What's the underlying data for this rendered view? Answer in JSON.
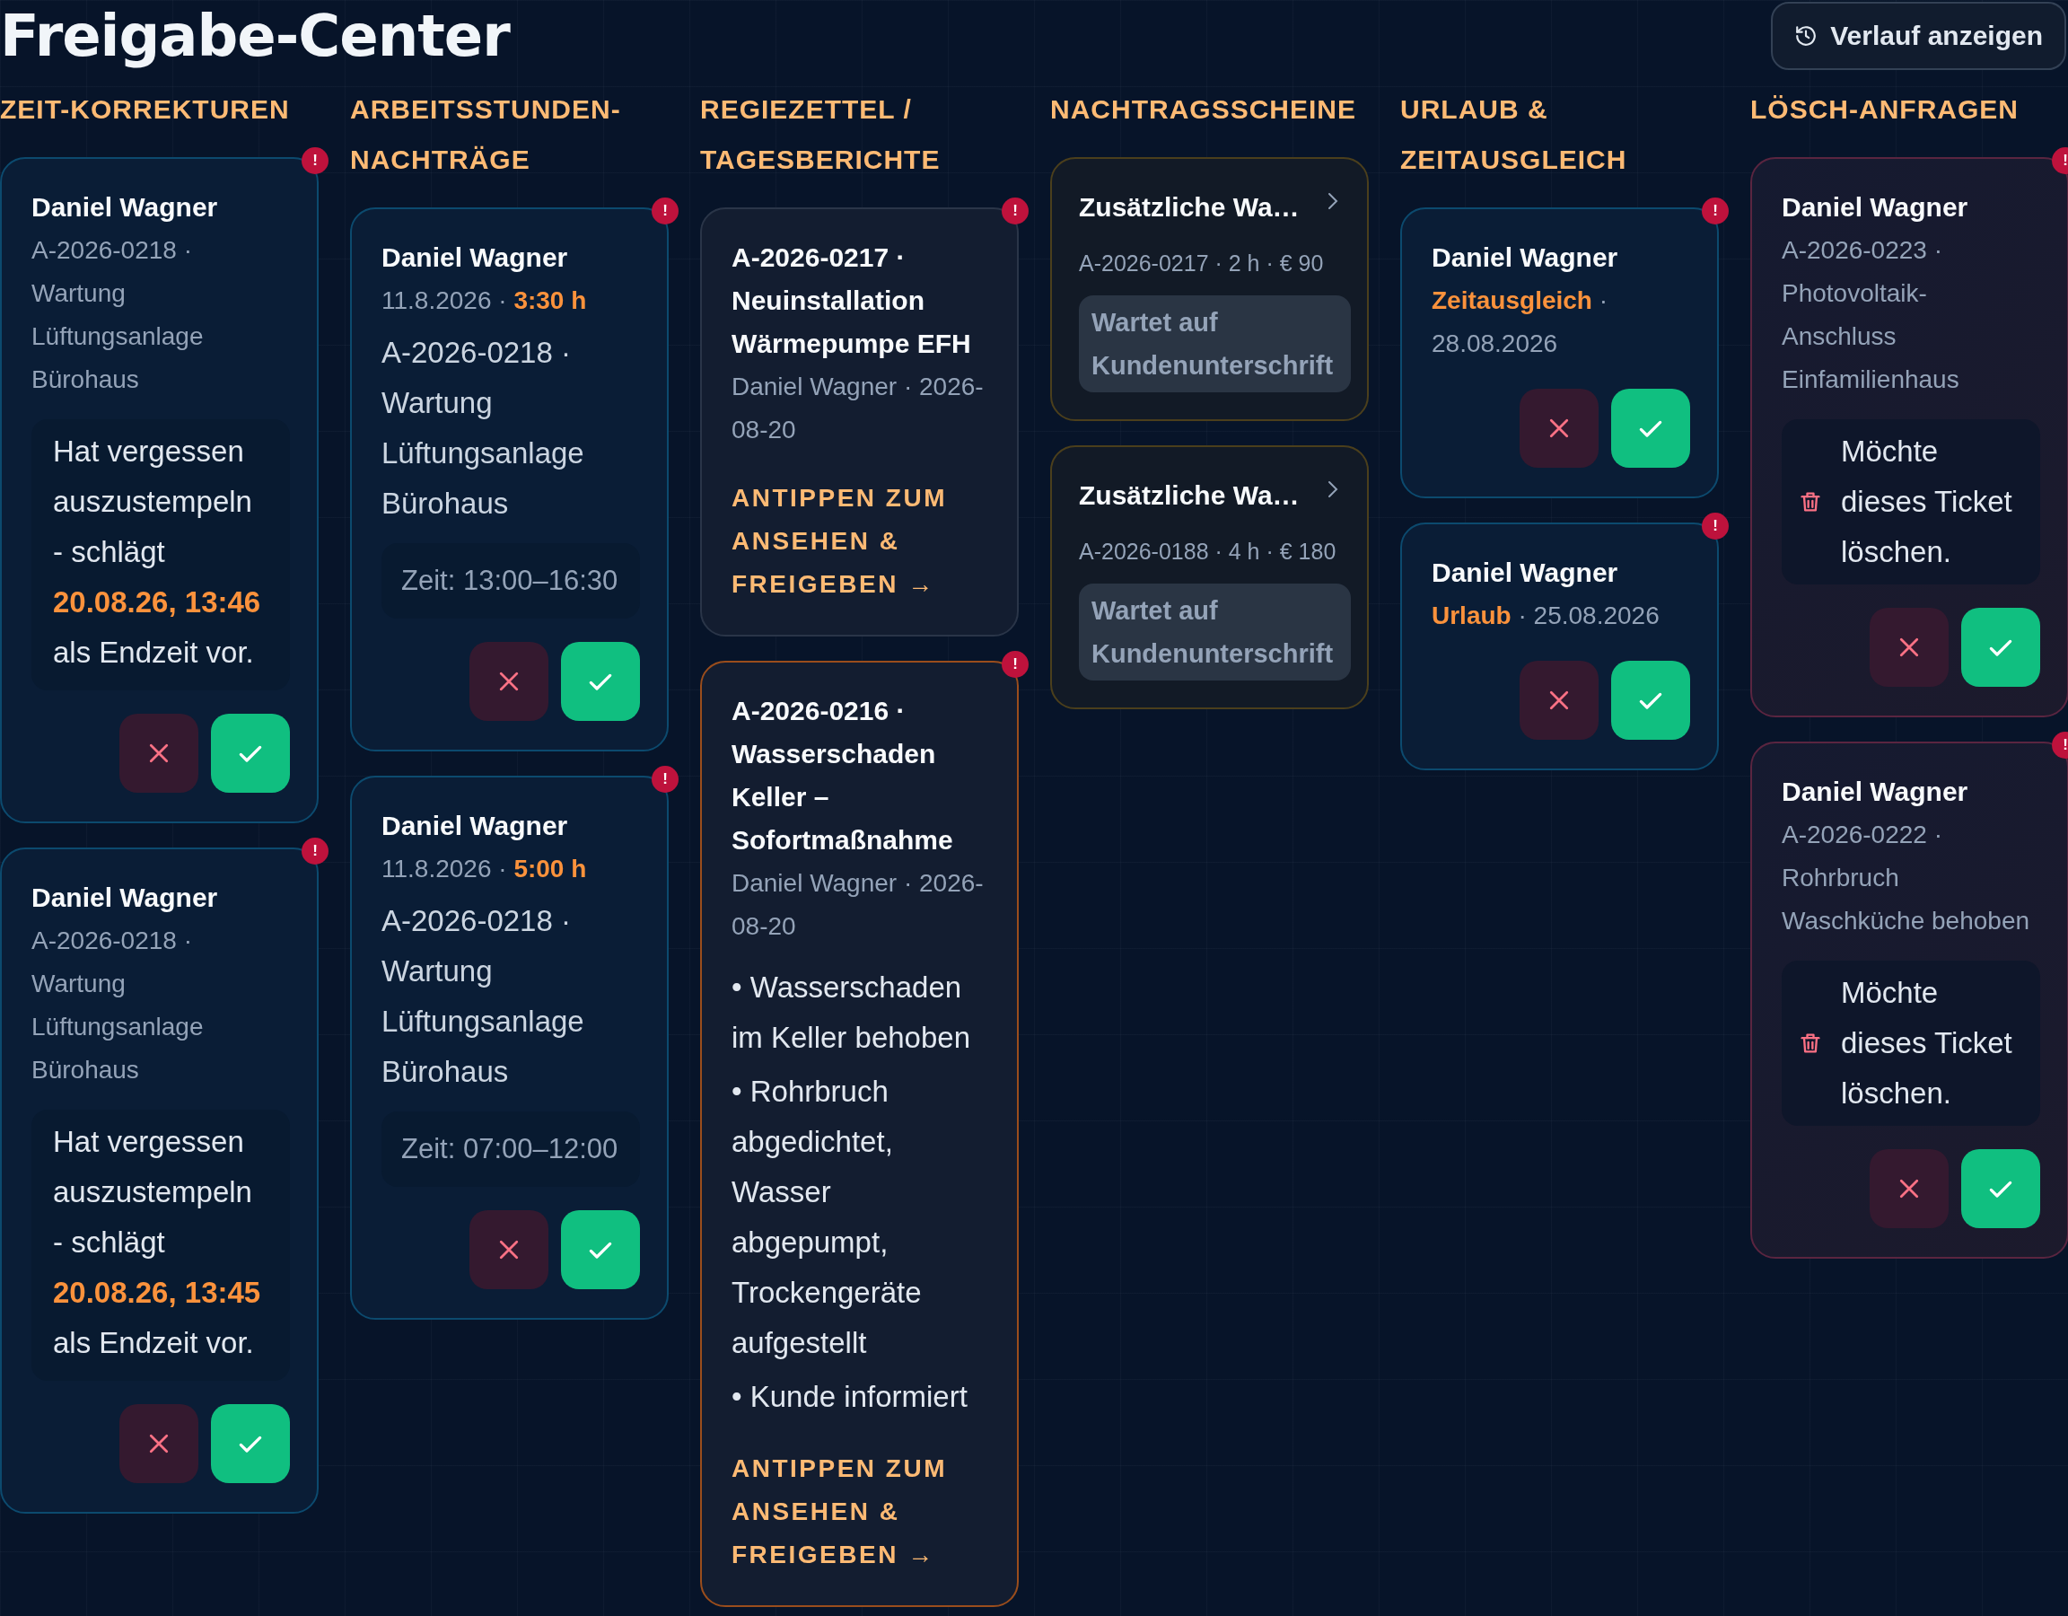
{
  "title": "Freigabe-Center",
  "history_button": {
    "label": "Verlauf anzeigen"
  },
  "columns": [
    {
      "title": "ZEIT-KORREKTUREN",
      "cards": [
        {
          "kind": "correction",
          "badge": "!",
          "name": "Daniel Wagner",
          "meta": "A-2026-0218 · Wartung Lüftungsanlage Bürohaus",
          "note": "Hat vergessen auszustempeln - schlägt **20.08.26, 13:46** als Endzeit vor."
        },
        {
          "kind": "correction",
          "badge": "!",
          "name": "Daniel Wagner",
          "meta": "A-2026-0218 · Wartung Lüftungsanlage Bürohaus",
          "note": "Hat vergessen auszustempeln - schlägt **20.08.26, 13:45** als Endzeit vor."
        }
      ]
    },
    {
      "title": "ARBEITSSTUNDEN-NACHTRÄGE",
      "cards": [
        {
          "kind": "hours",
          "badge": "!",
          "name": "Daniel Wagner",
          "detail": "11.8.2026 · **3:30 h**",
          "description": "A-2026-0218 · Wartung Lüftungsanlage Bürohaus",
          "time": "Zeit: 13:00–16:30"
        },
        {
          "kind": "hours",
          "badge": "!",
          "name": "Daniel Wagner",
          "detail": "11.8.2026 · **5:00 h**",
          "description": "A-2026-0218 · Wartung Lüftungsanlage Bürohaus",
          "time": "Zeit: 07:00–12:00"
        }
      ]
    },
    {
      "title": "REGIEZETTEL / TAGESBERICHTE",
      "cards": [
        {
          "kind": "report",
          "badge": "!",
          "highlighted": false,
          "name": "A-2026-0217 · Neuinstallation Wärmepumpe EFH",
          "meta": "Daniel Wagner · 2026-08-20",
          "action": "ANTIPPEN ZUM ANSEHEN & FREIGEBEN →"
        },
        {
          "kind": "report",
          "badge": "!",
          "highlighted": true,
          "name": "A-2026-0216 · Wasserschaden Keller – Sofortmaßnahme",
          "meta": "Daniel Wagner · 2026-08-20",
          "bullets": [
            "• Wasserschaden im Keller behoben",
            "• Rohrbruch abgedichtet, Wasser abgepumpt, Trockengeräte aufgestellt",
            "• Kunde informiert"
          ],
          "action": "ANTIPPEN ZUM ANSEHEN & FREIGEBEN →"
        }
      ]
    },
    {
      "title": "NACHTRAGSSCHEINE",
      "cards": [
        {
          "kind": "supplement",
          "name": "Zusätzliche Wa…",
          "meta": "A-2026-0217 · 2 h · € 90",
          "status": "Wartet auf Kundenunterschrift"
        },
        {
          "kind": "supplement",
          "name": "Zusätzliche Wa…",
          "meta": "A-2026-0188 · 4 h · € 180",
          "status": "Wartet auf Kundenunterschrift"
        }
      ]
    },
    {
      "title": "URLAUB & ZEITAUSGLEICH",
      "cards": [
        {
          "kind": "leave",
          "badge": "!",
          "name": "Daniel Wagner",
          "detail": "**Zeitausgleich** · 28.08.2026"
        },
        {
          "kind": "leave",
          "badge": "!",
          "name": "Daniel Wagner",
          "detail": "**Urlaub** · 25.08.2026"
        }
      ]
    },
    {
      "title": "LÖSCH-ANFRAGEN",
      "cards": [
        {
          "kind": "delete",
          "badge": "!",
          "name": "Daniel Wagner",
          "meta": "A-2026-0223 · Photovoltaik-Anschluss Einfamilienhaus",
          "note": "Möchte dieses Ticket löschen."
        },
        {
          "kind": "delete",
          "badge": "!",
          "name": "Daniel Wagner",
          "meta": "A-2026-0222 · Rohrbruch Waschküche behoben",
          "note": "Möchte dieses Ticket löschen."
        }
      ]
    }
  ]
}
